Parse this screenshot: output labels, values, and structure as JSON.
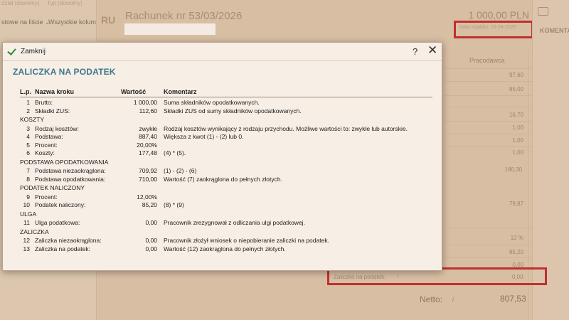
{
  "background": {
    "filters": [
      "dział (dowolny)",
      "Typ (dowolny)"
    ],
    "filters_row2": [
      "stowe na liście",
      "Wszystkie kolum"
    ],
    "invoice_code": "RU",
    "invoice_title": "Rachunek nr 53/03/2026",
    "amount": "1 000,00 PLN",
    "date_text": "Data wypłaty: 16-04-2026",
    "comments_label": "KOMENTARZE",
    "column_header": "Pracodawca",
    "right_values": [
      "97,60",
      "85,00",
      "16,70",
      "1,00",
      "1,00",
      "1,00",
      "180,30",
      "79,87",
      "12 %",
      "85,20",
      "0,00"
    ],
    "zaliczka_label": "Zaliczka na podatek:",
    "zaliczka_info": "i",
    "zaliczka_value": "0,00",
    "netto_label": "Netto:",
    "netto_info": "i",
    "netto_value": "807,53"
  },
  "dialog": {
    "close_label": "Zamknij",
    "help_symbol": "?",
    "close_symbol": "✕",
    "title": "ZALICZKA NA PODATEK",
    "headers": {
      "lp": "L.p.",
      "name": "Nazwa kroku",
      "value": "Wartość",
      "comment": "Komentarz"
    },
    "rows": [
      {
        "lp": "1",
        "name": "Brutto:",
        "value": "1 000,00",
        "comment": "Suma składników opodatkowanych."
      },
      {
        "lp": "2",
        "name": "Składki ZUS:",
        "value": "112,60",
        "comment": "Składki ZUS od sumy składników opodatkowanych."
      },
      {
        "section": "KOSZTY"
      },
      {
        "lp": "3",
        "name": "Rodzaj kosztów:",
        "value": "zwykłe",
        "comment": "Rodzaj kosztów wynikający z rodzaju przychodu. Możliwe wartości to: zwykłe lub autorskie."
      },
      {
        "lp": "4",
        "name": "Podstawa:",
        "value": "887,40",
        "comment": "Większa z kwot (1) - (2) lub 0."
      },
      {
        "lp": "5",
        "name": "Procent:",
        "value": "20,00%",
        "comment": ""
      },
      {
        "lp": "6",
        "name": "Koszty:",
        "value": "177,48",
        "comment": "(4) * (5)."
      },
      {
        "section": "PODSTAWA OPODATKOWANIA"
      },
      {
        "lp": "7",
        "name": "Podstawa niezaokrąglona:",
        "value": "709,92",
        "comment": "(1) - (2) - (6)"
      },
      {
        "lp": "8",
        "name": "Podstawa opodatkowania:",
        "value": "710,00",
        "comment": "Wartość (7) zaokrąglona do pełnych złotych."
      },
      {
        "section": "PODATEK NALICZONY"
      },
      {
        "lp": "9",
        "name": "Procent:",
        "value": "12,00%",
        "comment": ""
      },
      {
        "lp": "10",
        "name": "Podatek naliczony:",
        "value": "85,20",
        "comment": "(8) * (9)"
      },
      {
        "section": "ULGA"
      },
      {
        "lp": "11",
        "name": "Ulga podatkowa:",
        "value": "0,00",
        "comment": "Pracownik zrezygnował z odliczania ulgi podatkowej."
      },
      {
        "section": "ZALICZKA"
      },
      {
        "lp": "12",
        "name": "Zaliczka niezaokrąglona:",
        "value": "0,00",
        "comment": "Pracownik złożył wniosek o niepobieranie zaliczki na podatek."
      },
      {
        "lp": "13",
        "name": "Zaliczka na podatek:",
        "value": "0,00",
        "comment": "Wartość (12) zaokrąglona do pełnych złotych."
      }
    ]
  },
  "colors": {
    "accent_title": "#3b7890",
    "highlight_border": "#c0302e",
    "check": "#2f8a3a"
  }
}
